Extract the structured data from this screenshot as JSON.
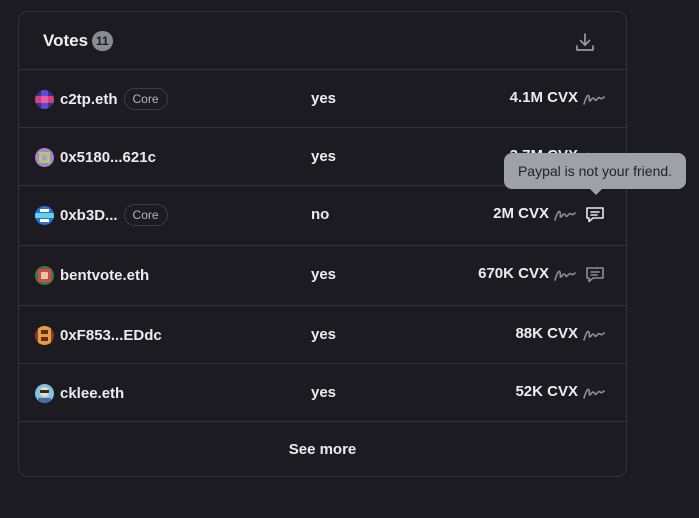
{
  "header": {
    "title": "Votes",
    "count": "11"
  },
  "votes": [
    {
      "name": "c2tp.eth",
      "badge": "Core",
      "choice": "yes",
      "power": "4.1M CVX"
    },
    {
      "name": "0x5180...621c",
      "badge": "",
      "choice": "yes",
      "power": "3.7M CVX"
    },
    {
      "name": "0xb3D...",
      "badge": "Core",
      "choice": "no",
      "power": "2M CVX",
      "has_comment": true
    },
    {
      "name": "bentvote.eth",
      "badge": "",
      "choice": "yes",
      "power": "670K CVX",
      "has_comment": true
    },
    {
      "name": "0xF853...EDdc",
      "badge": "",
      "choice": "yes",
      "power": "88K CVX"
    },
    {
      "name": "cklee.eth",
      "badge": "",
      "choice": "yes",
      "power": "52K CVX"
    }
  ],
  "see_more_label": "See more",
  "tooltip": "Paypal is not your friend.",
  "icons": {
    "download": "download-icon",
    "signature": "signature-icon",
    "comment": "comment-icon"
  },
  "colors": {
    "background": "#1c1b22",
    "border": "#34333b",
    "text": "#ececef",
    "muted": "#8a8a93",
    "tooltip_bg": "#9fa0a8"
  }
}
